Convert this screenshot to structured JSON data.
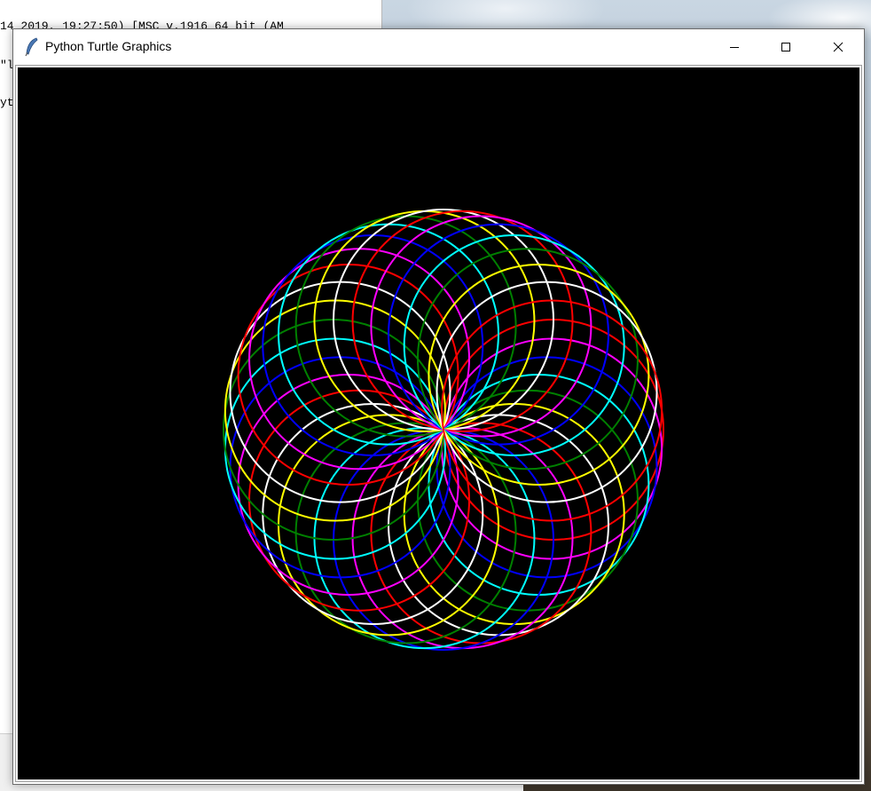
{
  "window": {
    "title": "Python Turtle Graphics",
    "app_icon": "feather-icon",
    "controls": [
      "minimize-icon",
      "maximize-icon",
      "close-icon"
    ]
  },
  "shell": {
    "lines": [
      "14 2019, 19:27:50) [MSC v.1916 64 bit (AM",
      "\"l",
      "yt"
    ]
  },
  "canvas": {
    "background": "#000000",
    "drawing": "spirograph-of-circles",
    "circle_count": 36,
    "pen_colors": [
      "#ff0000",
      "#ff00ff",
      "#0000ff",
      "#00ffff",
      "#008000",
      "#ffff00",
      "#ffffff"
    ]
  }
}
